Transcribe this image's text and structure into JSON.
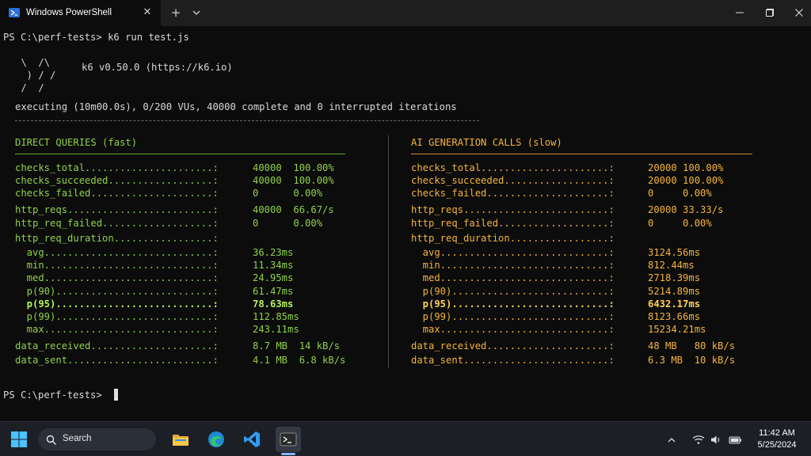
{
  "window": {
    "tab_title": "Windows PowerShell",
    "new_tab_symbol": "+",
    "tab_close_symbol": "✕"
  },
  "terminal": {
    "prompt_line": "PS C:\\perf-tests> ",
    "command": "k6 run test.js",
    "logo_lines": [
      " \\  /\\ ",
      "  ) / /",
      " /  /  "
    ],
    "version": "k6 v0.50.0 (https://k6.io)",
    "executing": "executing (10m00.0s), 0/200 VUs, 40000 complete and 0 interrupted iterations",
    "separator": "-------------------------------------------------------------------------------",
    "final_prompt": "PS C:\\perf-tests> "
  },
  "direct": {
    "title": "DIRECT QUERIES (fast)",
    "rows": [
      {
        "label": "checks_total......................:",
        "value": "40000  100.00%"
      },
      {
        "label": "checks_succeeded..................:",
        "value": "40000  100.00%"
      },
      {
        "label": "checks_failed.....................:",
        "value": "0      0.00%"
      },
      {
        "label": "http_reqs.........................:",
        "value": "40000  66.67/s"
      },
      {
        "label": "http_req_failed...................:",
        "value": "0      0.00%"
      },
      {
        "label": "http_req_duration.................:",
        "value": ""
      },
      {
        "label": "  avg.............................:",
        "value": "36.23ms"
      },
      {
        "label": "  min.............................:",
        "value": "11.34ms"
      },
      {
        "label": "  med.............................:",
        "value": "24.95ms"
      },
      {
        "label": "  p(90)...........................:",
        "value": "61.47ms"
      },
      {
        "label": "  p(95)...........................:",
        "value": "78.63ms"
      },
      {
        "label": "  p(99)...........................:",
        "value": "112.85ms"
      },
      {
        "label": "  max.............................:",
        "value": "243.11ms"
      },
      {
        "label": "data_received.....................:",
        "value": "8.7 MB  14 kB/s"
      },
      {
        "label": "data_sent.........................:",
        "value": "4.1 MB  6.8 kB/s"
      }
    ]
  },
  "ai": {
    "title": "AI GENERATION CALLS (slow)",
    "rows": [
      {
        "label": "checks_total......................:",
        "value": "20000 100.00%"
      },
      {
        "label": "checks_succeeded..................:",
        "value": "20000 100.00%"
      },
      {
        "label": "checks_failed.....................:",
        "value": "0     0.00%"
      },
      {
        "label": "http_reqs.........................:",
        "value": "20000 33.33/s"
      },
      {
        "label": "http_req_failed...................:",
        "value": "0     0.00%"
      },
      {
        "label": "http_req_duration.................:",
        "value": ""
      },
      {
        "label": "  avg.............................:",
        "value": "3124.56ms"
      },
      {
        "label": "  min.............................:",
        "value": "812.44ms"
      },
      {
        "label": "  med.............................:",
        "value": "2718.39ms"
      },
      {
        "label": "  p(90)...........................:",
        "value": "5214.89ms"
      },
      {
        "label": "  p(95)...........................:",
        "value": "6432.17ms"
      },
      {
        "label": "  p(99)...........................:",
        "value": "8123.66ms"
      },
      {
        "label": "  max.............................:",
        "value": "15234.21ms"
      },
      {
        "label": "data_received.....................:",
        "value": "48 MB   80 kB/s"
      },
      {
        "label": "data_sent.........................:",
        "value": "6.3 MB  10 kB/s"
      }
    ]
  },
  "taskbar": {
    "search_label": "Search",
    "time": "11:42 AM",
    "date": "5/25/2024",
    "apps": [
      "file-explorer-icon",
      "edge-icon",
      "vscode-icon",
      "terminal-icon"
    ]
  },
  "colors": {
    "direct_accent": "#8fd14a",
    "ai_accent": "#f4b43c",
    "background": "#0c0c0c"
  }
}
